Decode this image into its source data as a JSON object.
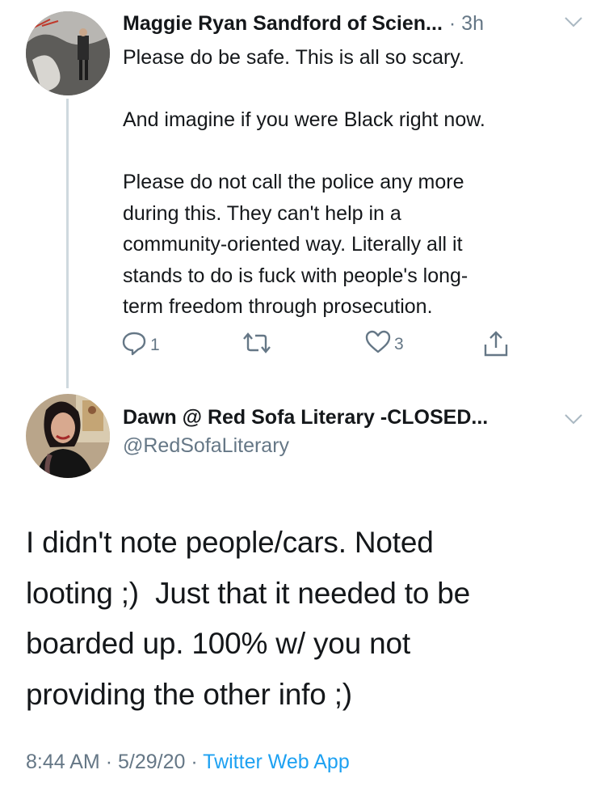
{
  "reply": {
    "author_name": "Maggie Ryan Sandford of Scien...",
    "separator": "·",
    "time": "3h",
    "paragraphs": [
      "Please do be safe. This is all so scary.",
      "And imagine if you were Black right now.",
      "Please do not call the police any more during this. They can't help in a community-oriented way. Literally all it stands to do is fuck with people's long-term freedom through prosecution."
    ],
    "lines": [
      "Please do be safe. This is all so scary.",
      "",
      "And imagine if you were Black right now.",
      "",
      "Please do not call the police any more",
      "during this. They can't help in a",
      "community-oriented way. Literally all it",
      "stands to do is fuck with people's long-",
      "term freedom through prosecution."
    ],
    "reply_count": "1",
    "retweet_count": "",
    "like_count": "3"
  },
  "main": {
    "author_name": "Dawn @ Red Sofa Literary -CLOSED...",
    "handle": "@RedSofaLiterary",
    "lines": [
      "I didn't note people/cars. Noted",
      "looting ;)  Just that it needed to be",
      "boarded up. 100% w/ you not",
      "providing the other info ;)"
    ],
    "time": "8:44 AM",
    "date": "5/29/20",
    "separator": "·",
    "source": "Twitter Web App"
  },
  "icons": {
    "reply": "reply-icon",
    "retweet": "retweet-icon",
    "like": "heart-icon",
    "share": "share-icon",
    "more": "chevron-down-icon"
  },
  "colors": {
    "text": "#14171a",
    "secondary": "#657786",
    "link": "#1da1f2",
    "thread_line": "#cfd9de"
  }
}
